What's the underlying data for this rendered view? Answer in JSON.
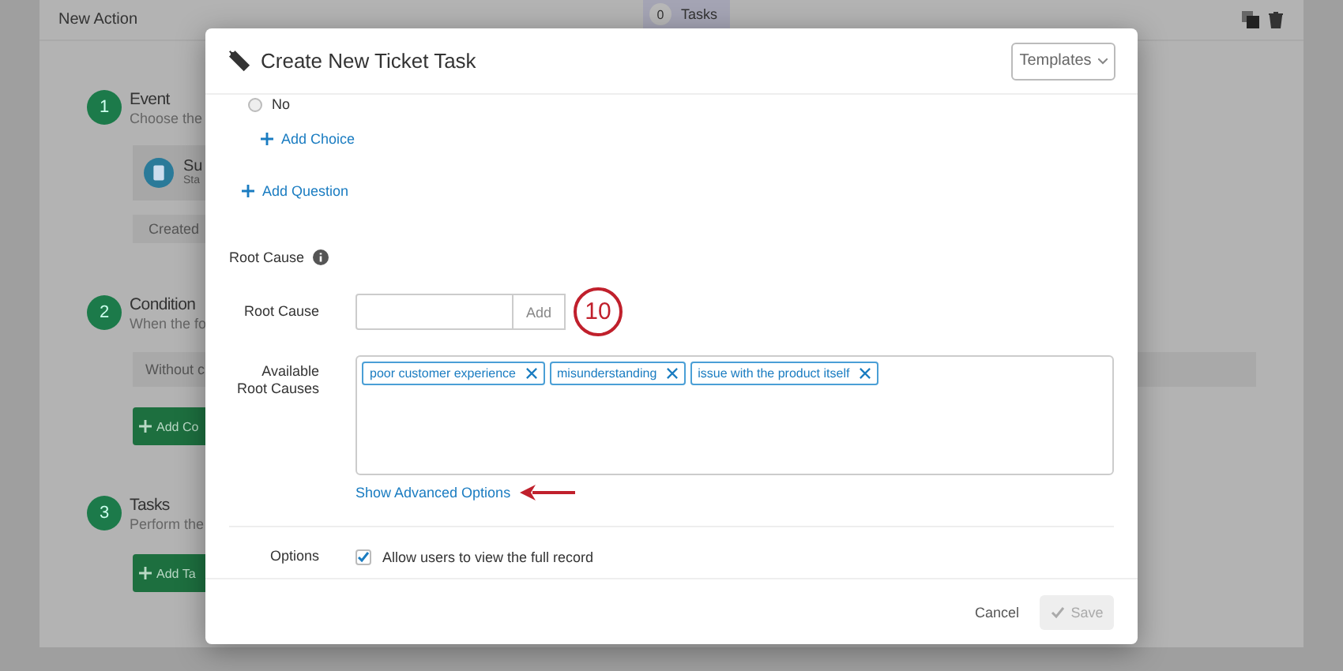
{
  "background": {
    "title": "New Action",
    "task_count": "0",
    "tasks_label": "Tasks",
    "steps": [
      {
        "number": "1",
        "title": "Event",
        "subtitle": "Choose the",
        "card": {
          "title": "Su",
          "subtitle": "Sta"
        },
        "chip": "Created"
      },
      {
        "number": "2",
        "title": "Condition",
        "subtitle": "When the fo",
        "field": "Without c",
        "button": "Add Co"
      },
      {
        "number": "3",
        "title": "Tasks",
        "subtitle": "Perform the",
        "button": "Add Ta"
      }
    ]
  },
  "modal": {
    "title": "Create New Ticket Task",
    "templates": "Templates",
    "choice": {
      "label": "No",
      "selected": false
    },
    "add_choice": "Add Choice",
    "add_question": "Add Question",
    "section": "Root Cause",
    "root_cause": {
      "label": "Root Cause",
      "add_button": "Add",
      "annotation": "10"
    },
    "available": {
      "label": "Available Root Causes",
      "tags": [
        "poor customer experience",
        "misunderstanding",
        "issue with the product itself"
      ]
    },
    "advanced_link": "Show Advanced Options",
    "options": {
      "label": "Options",
      "checkbox": {
        "label": "Allow users to view the full record",
        "checked": true
      }
    },
    "cancel": "Cancel",
    "save": {
      "label": "Save",
      "disabled": true
    }
  }
}
